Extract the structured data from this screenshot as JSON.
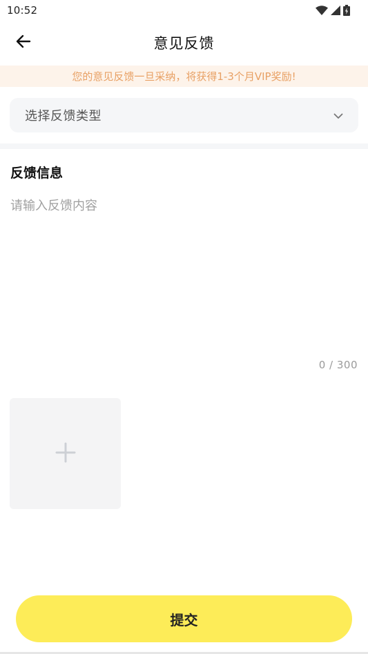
{
  "status_bar": {
    "time": "10:52"
  },
  "header": {
    "title": "意见反馈",
    "back_icon": "arrow-left-icon"
  },
  "notice": {
    "text": "您的意见反馈一旦采纳，将获得1-3个月VIP奖励!"
  },
  "type_select": {
    "placeholder": "选择反馈类型",
    "icon": "chevron-down-icon"
  },
  "feedback": {
    "section_title": "反馈信息",
    "placeholder": "请输入反馈内容",
    "value": "",
    "char_count": "0 / 300"
  },
  "image_upload": {
    "icon": "plus-icon"
  },
  "submit": {
    "label": "提交"
  },
  "colors": {
    "notice_bg": "#fdf3ea",
    "notice_text": "#e8a064",
    "submit_bg": "#fdec58",
    "field_bg": "#f5f6f8"
  }
}
